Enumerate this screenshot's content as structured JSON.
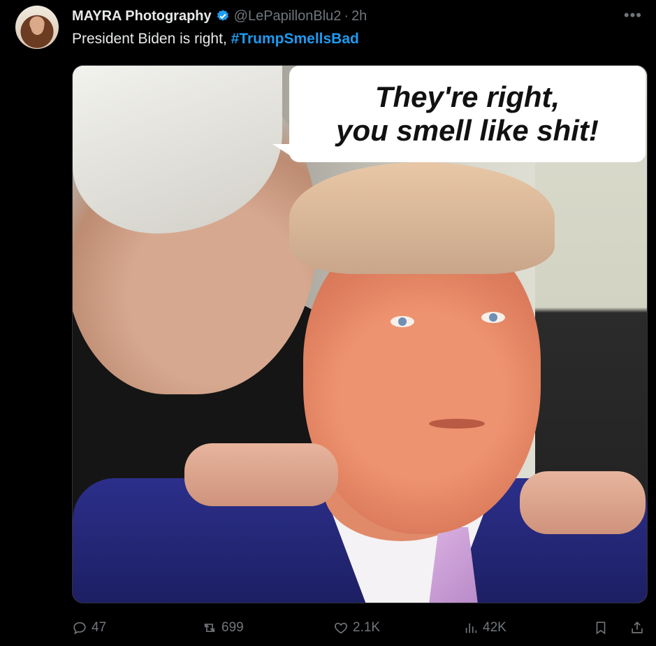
{
  "tweet": {
    "author_name": "MAYRA Photography",
    "handle": "@LePapillonBlu2",
    "separator": "·",
    "time": "2h",
    "more": "•••",
    "text": "President Biden is right, ",
    "hashtag": "#TrumpSmellsBad"
  },
  "media": {
    "bubble_line1": "They're right,",
    "bubble_line2": "you smell like shit!"
  },
  "actions": {
    "replies": "47",
    "reposts": "699",
    "likes": "2.1K",
    "views": "42K"
  },
  "colors": {
    "background": "#000000",
    "text": "#e7e9ea",
    "muted": "#71767b",
    "accent": "#1d9bf0"
  }
}
